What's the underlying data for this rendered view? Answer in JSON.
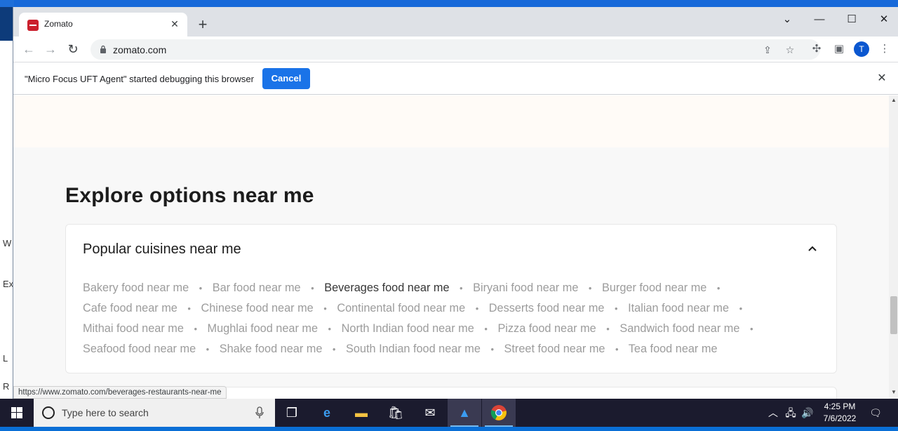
{
  "browser": {
    "tab_title": "Zomato",
    "url": "zomato.com",
    "profile_initial": "T"
  },
  "infobar": {
    "message": "\"Micro Focus UFT Agent\" started debugging this browser",
    "cancel_label": "Cancel"
  },
  "page": {
    "section_heading": "Explore options near me",
    "card_title": "Popular cuisines near me",
    "cuisines": [
      "Bakery food near me",
      "Bar food near me",
      "Beverages food near me",
      "Biryani food near me",
      "Burger food near me",
      "Cafe food near me",
      "Chinese food near me",
      "Continental food near me",
      "Desserts food near me",
      "Italian food near me",
      "Mithai food near me",
      "Mughlai food near me",
      "North Indian food near me",
      "Pizza food near me",
      "Sandwich food near me",
      "Seafood food near me",
      "Shake food near me",
      "South Indian food near me",
      "Street food near me",
      "Tea food near me"
    ],
    "hovered_index": 2,
    "status_url": "https://www.zomato.com/beverages-restaurants-near-me"
  },
  "background_window": {
    "fragments": [
      "W",
      "Ex",
      "L",
      "R"
    ]
  },
  "taskbar": {
    "search_placeholder": "Type here to search",
    "time": "4:25 PM",
    "date": "7/6/2022"
  },
  "colors": {
    "brand": "#cb202d",
    "chrome_blue": "#1a73e8",
    "link_grey": "#9c9c9c",
    "link_hover": "#363636"
  }
}
